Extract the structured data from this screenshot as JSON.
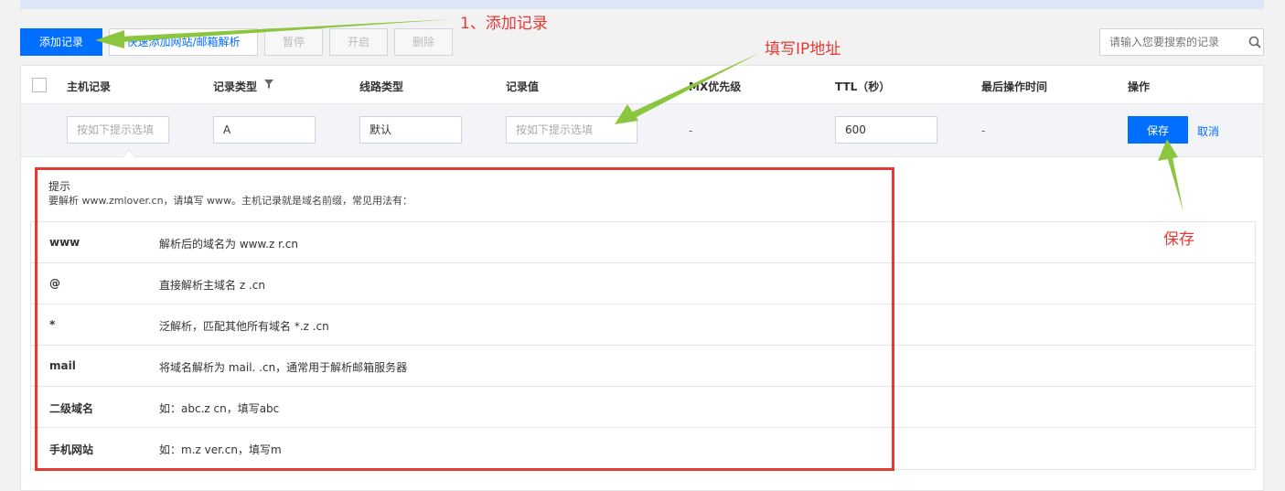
{
  "toolbar": {
    "add_record": "添加记录",
    "quick_add": "快速添加网站/邮箱解析",
    "pause": "暂停",
    "enable": "开启",
    "delete": "删除"
  },
  "search": {
    "placeholder": "请输入您要搜索的记录",
    "icon": "search-icon"
  },
  "table": {
    "headers": {
      "host": "主机记录",
      "type": "记录类型",
      "line": "线路类型",
      "value": "记录值",
      "mx": "MX优先级",
      "ttl": "TTL（秒）",
      "last_op_time": "最后操作时间",
      "action": "操作"
    },
    "edit_row": {
      "host_placeholder": "按如下提示选填",
      "type_value": "A",
      "line_value": "默认",
      "value_placeholder": "按如下提示选填",
      "mx_value": "-",
      "ttl_value": "600",
      "time_value": "-",
      "save": "保存",
      "cancel": "取消"
    }
  },
  "tip": {
    "title": "提示",
    "desc": "要解析 www.zmlover.cn，请填写 www。主机记录就是域名前缀，常见用法有：",
    "rows": [
      {
        "key": "www",
        "value": "解析后的域名为 www.z      r.cn"
      },
      {
        "key": "@",
        "value": "直接解析主域名 z        .cn"
      },
      {
        "key": "*",
        "value": "泛解析，匹配其他所有域名 *.z       .cn"
      },
      {
        "key": "mail",
        "value": "将域名解析为 mail.        .cn，通常用于解析邮箱服务器"
      },
      {
        "key": "二级域名",
        "value": "如：abc.z       cn，填写abc"
      },
      {
        "key": "手机网站",
        "value": "如：m.z      ver.cn，填写m"
      }
    ]
  },
  "annotations": {
    "step1": "1、添加记录",
    "fill_ip": "填写IP地址",
    "save": "保存"
  },
  "colors": {
    "primary": "#006eff",
    "annotation_red": "#e53935",
    "arrow_green": "#8cc63f"
  }
}
